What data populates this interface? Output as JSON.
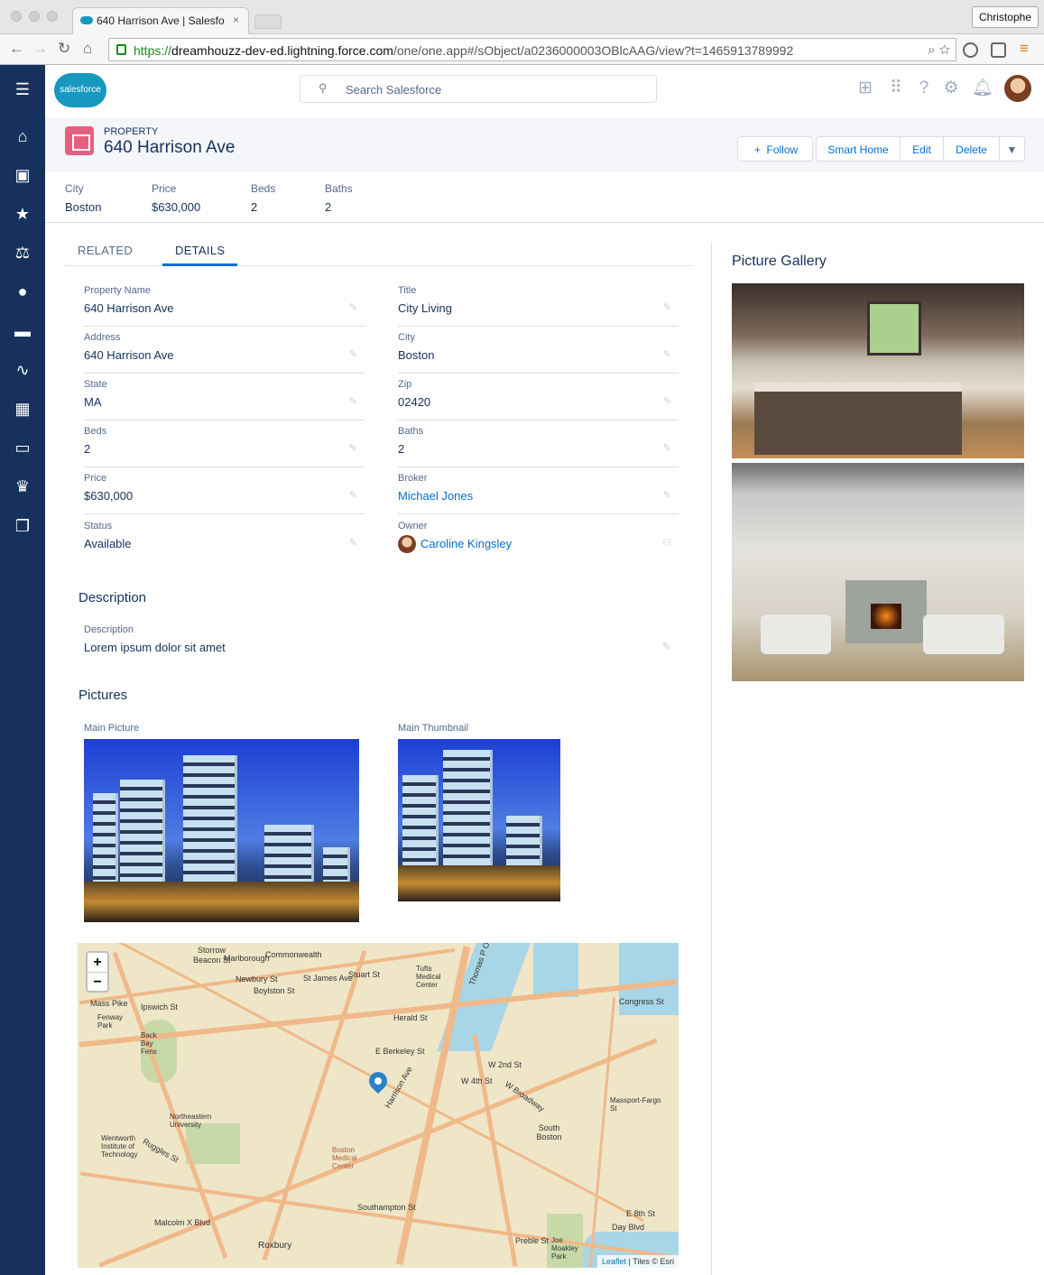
{
  "browser": {
    "tab_title": "640 Harrison Ave | Salesfo",
    "tab_close": "×",
    "profile_name": "Christophe",
    "url_scheme": "https://",
    "url_host": "dreamhouzz-dev-ed.lightning.force.com",
    "url_path": "/one/one.app#/sObject/a0236000003OBlcAAG/view?t=1465913789992"
  },
  "header": {
    "logo_text": "salesforce",
    "search_placeholder": "Search Salesforce"
  },
  "record": {
    "type_label": "PROPERTY",
    "title": "640 Harrison Ave",
    "actions": {
      "follow": "Follow",
      "smart_home": "Smart Home",
      "edit": "Edit",
      "delete": "Delete"
    }
  },
  "highlights": [
    {
      "label": "City",
      "value": "Boston"
    },
    {
      "label": "Price",
      "value": "$630,000"
    },
    {
      "label": "Beds",
      "value": "2"
    },
    {
      "label": "Baths",
      "value": "2"
    }
  ],
  "tabs": {
    "related": "RELATED",
    "details": "DETAILS"
  },
  "fields": [
    {
      "label": "Property Name",
      "value": "640 Harrison Ave"
    },
    {
      "label": "Title",
      "value": "City Living"
    },
    {
      "label": "Address",
      "value": "640 Harrison Ave"
    },
    {
      "label": "City",
      "value": "Boston"
    },
    {
      "label": "State",
      "value": "MA"
    },
    {
      "label": "Zip",
      "value": "02420"
    },
    {
      "label": "Beds",
      "value": "2"
    },
    {
      "label": "Baths",
      "value": "2"
    },
    {
      "label": "Price",
      "value": "$630,000"
    },
    {
      "label": "Broker",
      "value": "Michael Jones"
    },
    {
      "label": "Status",
      "value": "Available"
    },
    {
      "label": "Owner",
      "value": "Caroline Kingsley"
    }
  ],
  "description": {
    "section_title": "Description",
    "label": "Description",
    "value": "Lorem ipsum dolor sit amet"
  },
  "pictures": {
    "section_title": "Pictures",
    "main_picture_label": "Main Picture",
    "main_thumbnail_label": "Main Thumbnail"
  },
  "gallery": {
    "title": "Picture Gallery"
  },
  "map": {
    "zoom_in": "+",
    "zoom_out": "−",
    "attribution_link": "Leaflet",
    "attribution_text": " | Tiles © Esri",
    "labels": {
      "storrow": "Storrow",
      "beacon": "Beacon St",
      "marlborough": "Marlborough",
      "commonwealth": "Commonwealth",
      "newbury": "Newbury St",
      "boylston": "Boylston St",
      "st_james": "St James Ave",
      "stuart": "Stuart St",
      "tufts": "Tufts Medical Center",
      "mass_pike": "Mass Pike",
      "ipswich": "Ipswich St",
      "fenway_park": "Fenway Park",
      "back_bay_fens": "Back Bay Fens",
      "herald": "Herald St",
      "e_berkeley": "E Berkeley St",
      "harrison": "Harrison Ave",
      "w_2nd": "W 2nd St",
      "w_4th": "W 4th St",
      "w_broadway": "W Broadway",
      "massport": "Massport-Fargo St",
      "south_boston": "South Boston",
      "northeastern": "Northeastern University",
      "wentworth": "Wentworth Institute of Technology",
      "ruggles": "Ruggles St",
      "boston_medical": "Boston Medical Center",
      "southampton": "Southampton St",
      "malcolm_x": "Malcolm X Blvd",
      "roxbury": "Roxbury",
      "day_blvd": "Day Blvd",
      "e_8th": "E 8th St",
      "joe_moakley": "Joe Moakley Park",
      "congress": "Congress St",
      "preble": "Preble St",
      "thomas_p": "Thomas P O"
    }
  }
}
